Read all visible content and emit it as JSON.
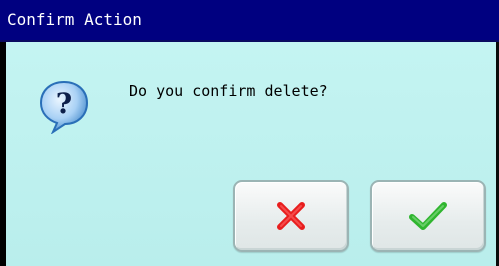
{
  "dialog": {
    "title": "Confirm Action",
    "message": "Do you confirm delete?"
  },
  "icons": {
    "question": "question-bubble-icon",
    "cancel": "red-x-icon",
    "confirm": "green-check-icon"
  },
  "colors": {
    "title_bar": "#000080",
    "title_text": "#ffffff",
    "content_bg": "#c0f0f0",
    "cancel_accent": "#e81e1e",
    "confirm_accent": "#2fb52f",
    "question_bubble": "#2a6fb8"
  }
}
